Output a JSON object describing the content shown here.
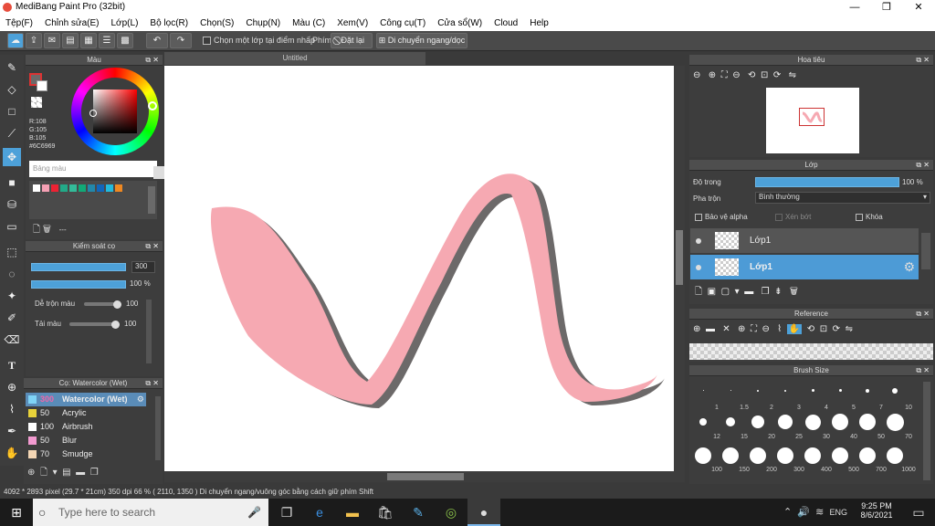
{
  "window": {
    "title": "MediBang Paint Pro (32bit)"
  },
  "menu": [
    "Tệp(F)",
    "Chỉnh sửa(E)",
    "Lớp(L)",
    "Bộ lọc(R)",
    "Chọn(S)",
    "Chụp(N)",
    "Màu (C)",
    "Xem(V)",
    "Công cụ(T)",
    "Cửa sổ(W)",
    "Cloud",
    "Help"
  ],
  "toolbar": {
    "select_layer_label": "Chọn một lớp tại điểm nhấp",
    "key_label": "Phím",
    "reset_label": "Đặt lại",
    "move_label": "Di chuyển ngang/dọc"
  },
  "canvas": {
    "tab_title": "Untitled"
  },
  "color_panel": {
    "title": "Màu",
    "r": "R:108",
    "g": "G:105",
    "b": "B:105",
    "hex": "#6C6969",
    "palette_title": "Bảng màu",
    "palette_name": "---",
    "main_color": "#6c6969"
  },
  "brush_control": {
    "title": "Kiểm soát cọ",
    "size_value": "300",
    "opacity_value": "100 %",
    "blend_label": "Dễ trộn màu",
    "blend_value": "100",
    "ink_label": "Tải màu",
    "ink_value": "100"
  },
  "brush_list": {
    "title": "Cọ: Watercolor (Wet)",
    "items": [
      {
        "size": "300",
        "name": "Watercolor (Wet)",
        "color": "#7fd3f5"
      },
      {
        "size": "50",
        "name": "Acrylic",
        "color": "#e8d23a"
      },
      {
        "size": "100",
        "name": "Airbrush",
        "color": "#ffffff"
      },
      {
        "size": "50",
        "name": "Blur",
        "color": "#f29ad0"
      },
      {
        "size": "70",
        "name": "Smudge",
        "color": "#f4d6b4"
      }
    ]
  },
  "navigator": {
    "title": "Hoa tiêu"
  },
  "layer_panel": {
    "title": "Lớp",
    "opacity_label": "Độ trong",
    "opacity_value": "100 %",
    "opacity_fraction": 1.0,
    "blend_label": "Pha trộn",
    "blend_value": "Bình thường",
    "protect_alpha_label": "Bảo vệ alpha",
    "clip_label": "Xén bớt",
    "lock_label": "Khóa",
    "layers": [
      {
        "name": "Lớp1"
      },
      {
        "name": "Lớp1",
        "selected": true
      }
    ]
  },
  "reference": {
    "title": "Reference"
  },
  "brush_size": {
    "title": "Brush Size",
    "sizes": [
      "1",
      "1.5",
      "2",
      "3",
      "4",
      "5",
      "7",
      "10",
      "12",
      "15",
      "20",
      "25",
      "30",
      "40",
      "50",
      "70",
      "100",
      "150",
      "200",
      "300",
      "400",
      "500",
      "700",
      "1000"
    ]
  },
  "status": {
    "text": "4092 * 2893 pixel   (29.7 * 21cm)   350 dpi   66 %   ( 2110, 1350 )   Di chuyển ngang/vuông góc bằng cách giữ phím Shift"
  },
  "taskbar": {
    "search_placeholder": "Type here to search",
    "lang": "ENG",
    "time": "9:25 PM",
    "date": "8/6/2021"
  },
  "colors": {
    "accent": "#4da1d9",
    "stroke_pink": "#f6a9b2",
    "stroke_shadow": "#6c6969"
  }
}
